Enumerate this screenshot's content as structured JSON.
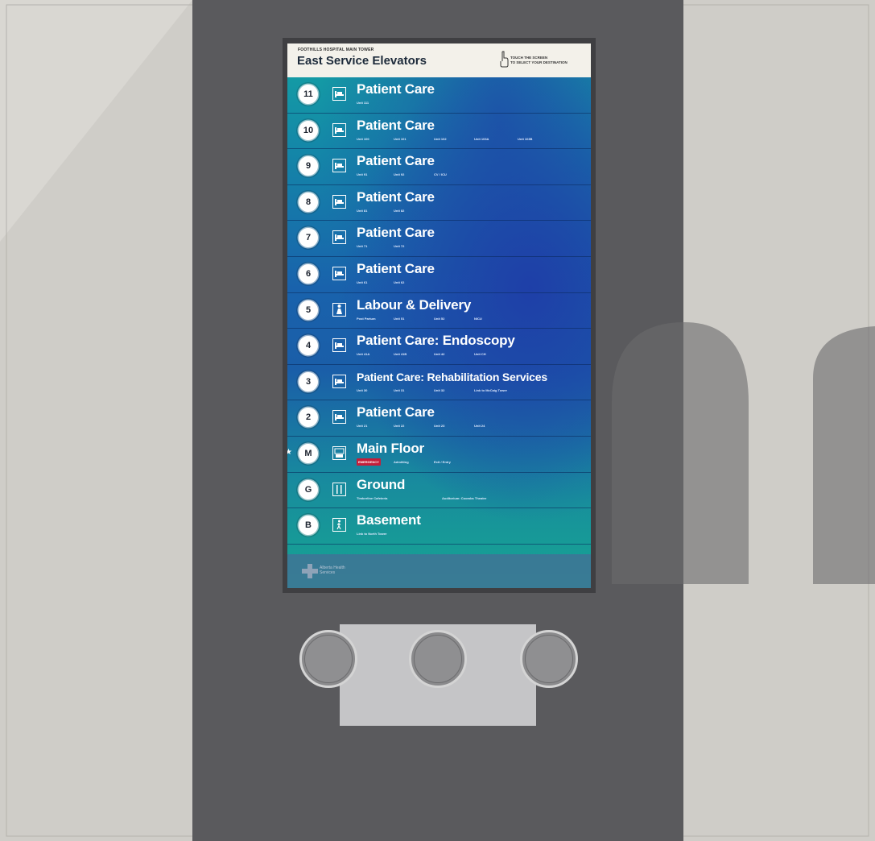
{
  "header": {
    "subtitle": "FOOTHILLS HOSPITAL MAIN TOWER",
    "title": "East Service Elevators",
    "touch_hint": [
      "TOUCH THE SCREEN",
      "TO SELECT YOUR DESTINATION"
    ]
  },
  "floors": [
    {
      "badge": "11",
      "icon": "bed-icon",
      "title": "Patient Care",
      "subs": [
        "Unit 111"
      ]
    },
    {
      "badge": "10",
      "icon": "bed-icon",
      "title": "Patient Care",
      "subs": [
        "Unit 100",
        "Unit 101",
        "Unit 102",
        "Unit 103A",
        "Unit 103B"
      ]
    },
    {
      "badge": "9",
      "icon": "bed-icon",
      "title": "Patient Care",
      "subs": [
        "Unit 91",
        "Unit 92",
        "CV / ICU"
      ]
    },
    {
      "badge": "8",
      "icon": "bed-icon",
      "title": "Patient Care",
      "subs": [
        "Unit 81",
        "Unit 82"
      ]
    },
    {
      "badge": "7",
      "icon": "bed-icon",
      "title": "Patient Care",
      "subs": [
        "Unit 71",
        "Unit 72"
      ]
    },
    {
      "badge": "6",
      "icon": "bed-icon",
      "title": "Patient Care",
      "subs": [
        "Unit 61",
        "Unit 62"
      ]
    },
    {
      "badge": "5",
      "icon": "mother-baby-icon",
      "title": "Labour & Delivery",
      "subs": [
        "Post Partum",
        "Unit 51",
        "Unit 52",
        "NICU"
      ]
    },
    {
      "badge": "4",
      "icon": "bed-icon",
      "title": "Patient Care: Endoscopy",
      "subs": [
        "Unit 41A",
        "Unit 41B",
        "Unit 42",
        "Unit CH"
      ]
    },
    {
      "badge": "3",
      "icon": "bed-icon",
      "title": "Patient Care: Rehabilitation Services",
      "subs": [
        "Unit 30",
        "Unit 31",
        "Unit 32",
        "Link to McCaig Tower"
      ]
    },
    {
      "badge": "2",
      "icon": "bed-icon",
      "title": "Patient Care",
      "subs": [
        "Unit 21",
        "Unit 22",
        "Unit 23",
        "Unit 24"
      ]
    },
    {
      "badge": "M",
      "icon": "info-desk-icon",
      "title": "Main Floor",
      "emergency": "EMERGENCY",
      "subs": [
        "Admitting",
        "Exit / Entry"
      ],
      "current": true
    },
    {
      "badge": "G",
      "icon": "fork-knife-icon",
      "title": "Ground",
      "subs": [
        "Timberline Cafeteria",
        "Auditorium: Coombs Theatre"
      ]
    },
    {
      "badge": "B",
      "icon": "walking-person-icon",
      "title": "Basement",
      "subs": [
        "Link to North Tower"
      ]
    }
  ],
  "current_marker": "★",
  "footer": {
    "logo_text": [
      "Alberta Health",
      "Services"
    ]
  },
  "colors": {
    "wall": "#cfcdc8",
    "panel": "#5a5a5d",
    "header_bg": "#f3f1ea",
    "emergency": "#c41e3a",
    "screen_teal": "#14a3a3",
    "screen_blue": "#1a5ea8"
  }
}
